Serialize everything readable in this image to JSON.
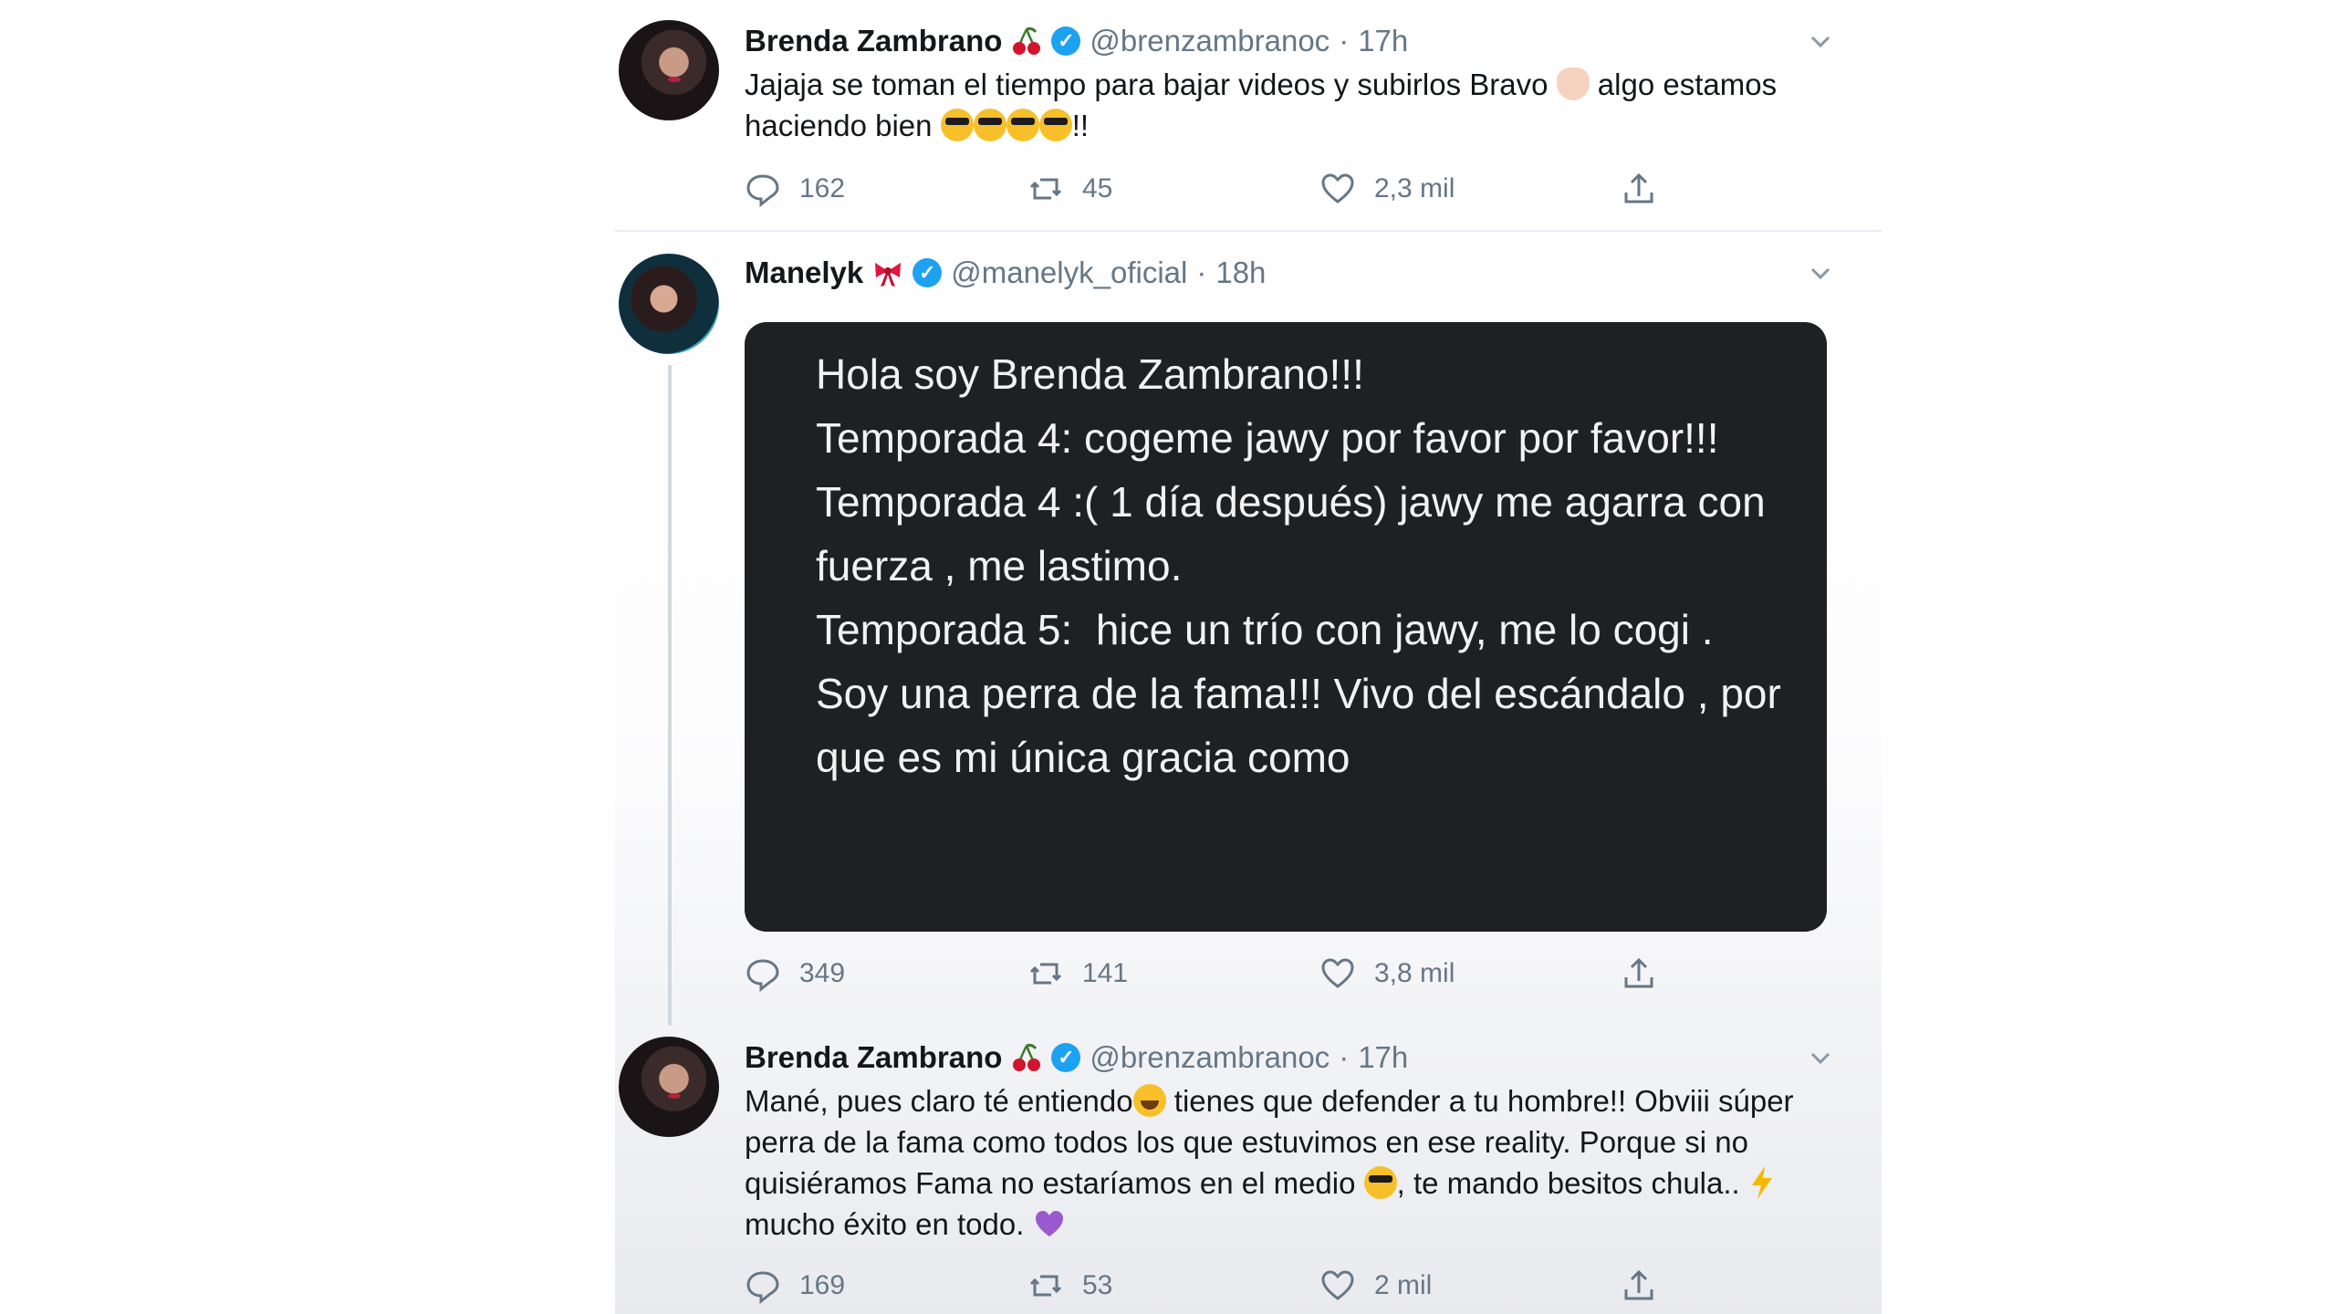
{
  "tweets": [
    {
      "name": "Brenda Zambrano",
      "handle": "@brenzambranoc",
      "separator": "·",
      "time": "17h",
      "text_part1": "Jajaja se toman el tiempo para bajar videos y subirlos Bravo ",
      "text_part2": " algo estamos haciendo bien ",
      "text_part3": "!!",
      "replies": "162",
      "retweets": "45",
      "likes": "2,3 mil"
    },
    {
      "name": "Manelyk",
      "handle": "@manelyk_oficial",
      "separator": "·",
      "time": "18h",
      "media_text": "Hola soy Brenda Zambrano!!!\nTemporada 4: cogeme jawy por favor por favor!!!\nTemporada 4 :( 1 día después) jawy me agarra con fuerza , me lastimo.\nTemporada 5:  hice un trío con jawy, me lo cogi .\nSoy una perra de la fama!!! Vivo del escándalo , por que es mi única gracia como",
      "replies": "349",
      "retweets": "141",
      "likes": "3,8 mil"
    },
    {
      "name": "Brenda Zambrano",
      "handle": "@brenzambranoc",
      "separator": "·",
      "time": "17h",
      "text_part1": "Mané, pues claro té entiendo",
      "text_part2": " tienes que defender a tu hombre!! Obviii súper perra de la fama como todos los que estuvimos en ese reality. Porque si no quisiéramos Fama no estaríamos en el medio ",
      "text_part3": ", te mando besitos chula.. ",
      "text_part4": " mucho éxito en todo. ",
      "replies": "169",
      "retweets": "53",
      "likes": "2 mil"
    }
  ],
  "icons": {
    "verified": "verified-badge-icon",
    "cherries": "cherries-emoji-icon",
    "bow": "ribbon-bow-emoji-icon",
    "reply": "reply-icon",
    "retweet": "retweet-icon",
    "like": "heart-icon",
    "share": "share-icon",
    "more": "chevron-down-icon"
  },
  "colors": {
    "verified_blue": "#1da1f2",
    "secondary_text": "#657786",
    "media_bg": "#1f2022"
  }
}
